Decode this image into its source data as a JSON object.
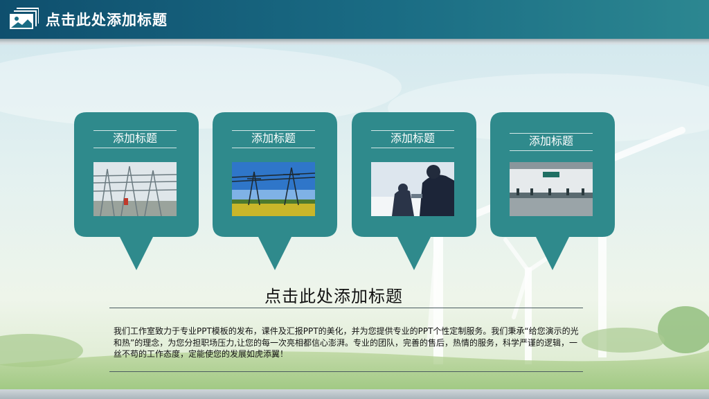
{
  "header": {
    "title": "点击此处添加标题",
    "icon": "image-icon"
  },
  "cards": [
    {
      "title": "添加标题",
      "photo": "substation-photo"
    },
    {
      "title": "添加标题",
      "photo": "transmission-tower-photo"
    },
    {
      "title": "添加标题",
      "photo": "workers-in-snow-photo"
    },
    {
      "title": "添加标题",
      "photo": "service-hall-photo"
    }
  ],
  "main": {
    "title": "点击此处添加标题",
    "body": "我们工作室致力于专业PPT模板的发布，课件及汇报PPT的美化，并为您提供专业的PPT个性定制服务。我们秉承“给您演示的光和热”的理念，为您分担职场压力,让您的每一次亮相都信心澎湃。专业的团队，完善的售后，热情的服务，科学严谨的逻辑，一丝不苟的工作态度，定能使您的发展如虎添翼！"
  },
  "colors": {
    "header": "#1a6c84",
    "card": "#2f8a8c",
    "text": "#111111"
  }
}
